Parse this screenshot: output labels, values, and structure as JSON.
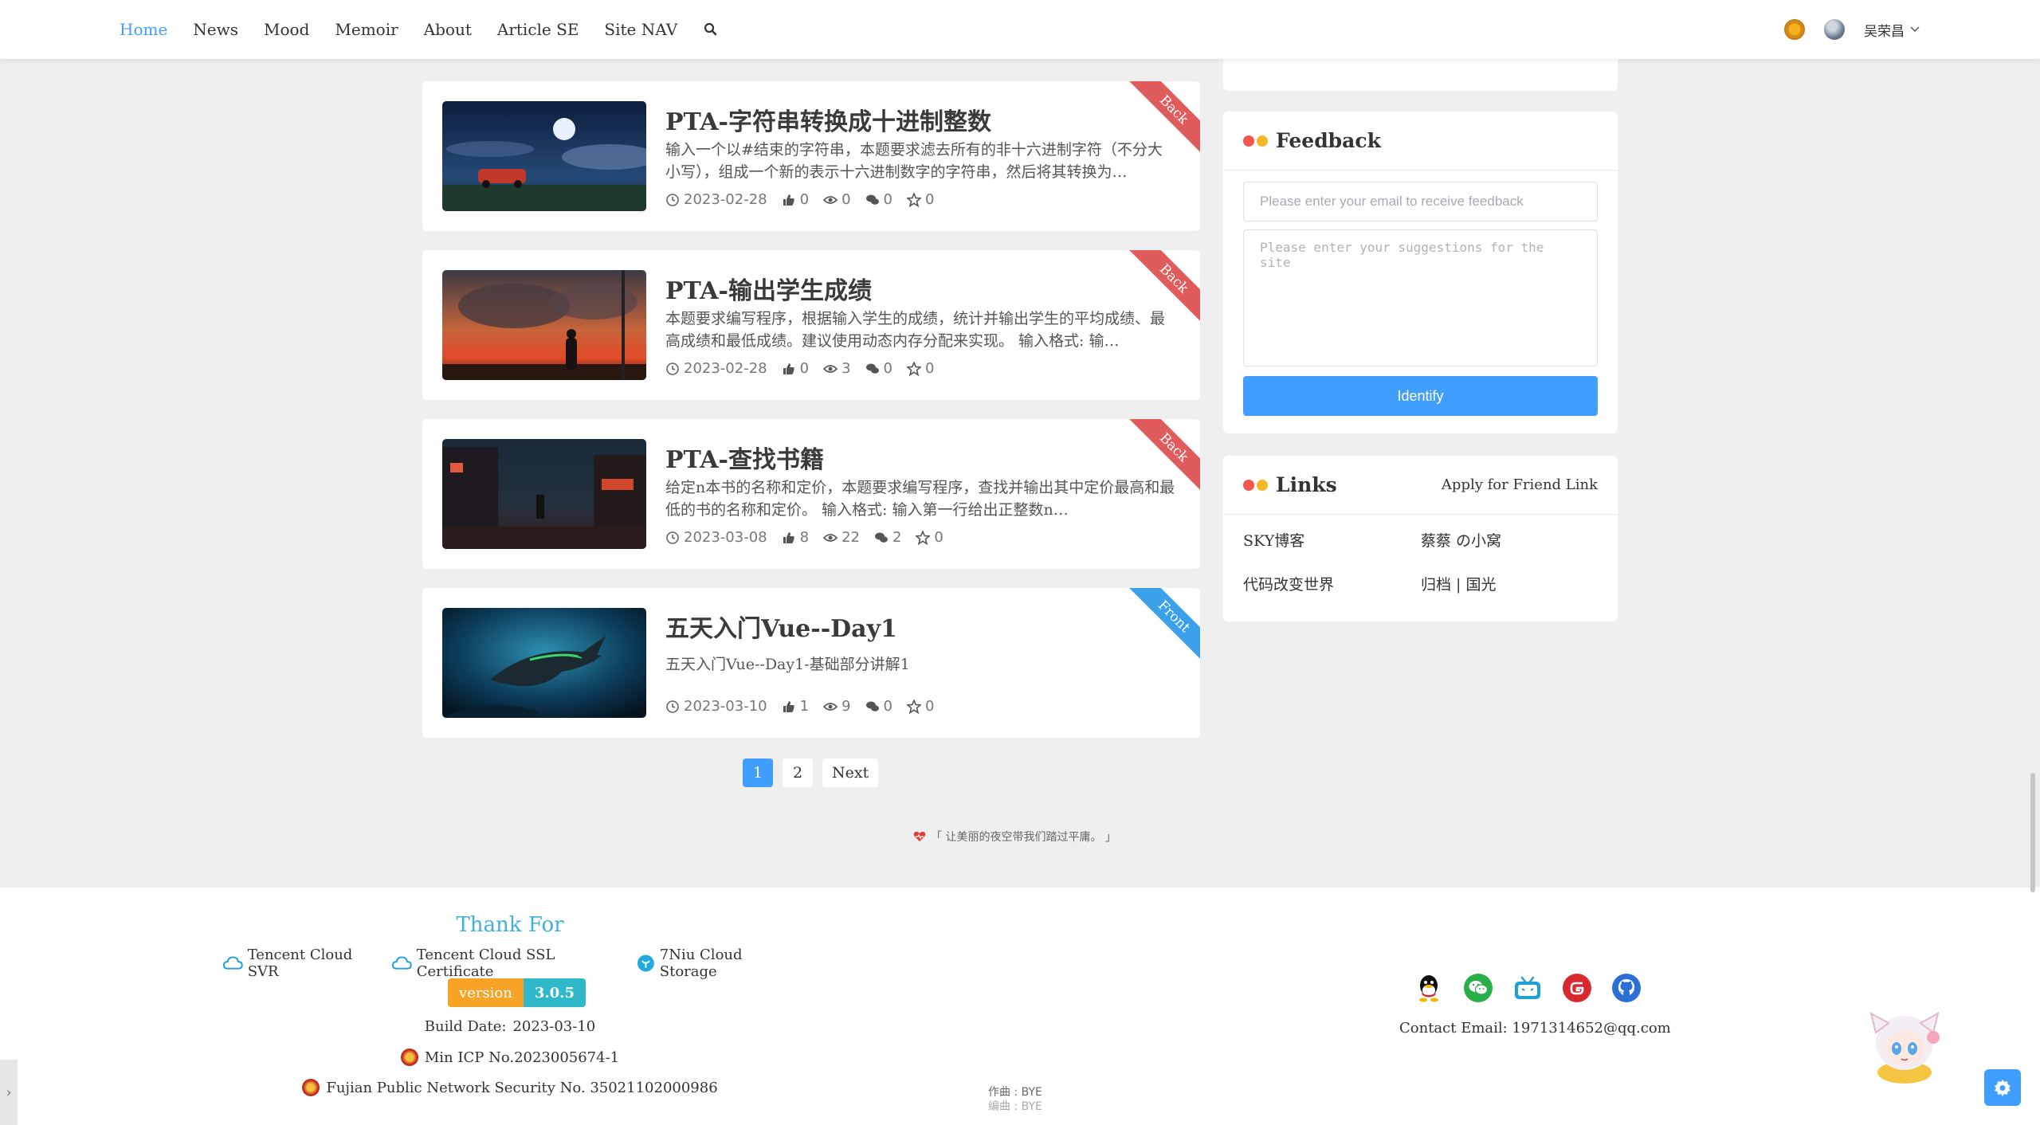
{
  "nav": {
    "items": [
      {
        "label": "Home",
        "active": true
      },
      {
        "label": "News",
        "active": false
      },
      {
        "label": "Mood",
        "active": false
      },
      {
        "label": "Memoir",
        "active": false
      },
      {
        "label": "About",
        "active": false
      },
      {
        "label": "Article SE",
        "active": false
      },
      {
        "label": "Site NAV",
        "active": false
      }
    ],
    "search_icon": "search-icon",
    "user_name": "吴荣昌"
  },
  "articles": [
    {
      "title": "PTA-字符串转换成十进制整数",
      "excerpt": "输入一个以#结束的字符串，本题要求滤去所有的非十六进制字符（不分大小写），组成一个新的表示十六进制数字的字符串，然后将其转换为…",
      "date": "2023-02-28",
      "likes": "0",
      "views": "0",
      "comments": "0",
      "stars": "0",
      "ribbon": "Back",
      "ribbon_color": "#e05b5b"
    },
    {
      "title": "PTA-输出学生成绩",
      "excerpt": "本题要求编写程序，根据输入学生的成绩，统计并输出学生的平均成绩、最高成绩和最低成绩。建议使用动态内存分配来实现。 输入格式: 输…",
      "date": "2023-02-28",
      "likes": "0",
      "views": "3",
      "comments": "0",
      "stars": "0",
      "ribbon": "Back",
      "ribbon_color": "#e05b5b"
    },
    {
      "title": "PTA-查找书籍",
      "excerpt": "给定n本书的名称和定价，本题要求编写程序，查找并输出其中定价最高和最低的书的名称和定价。 输入格式: 输入第一行给出正整数n…",
      "date": "2023-03-08",
      "likes": "8",
      "views": "22",
      "comments": "2",
      "stars": "0",
      "ribbon": "Back",
      "ribbon_color": "#e05b5b"
    },
    {
      "title": "五天入门Vue--Day1",
      "excerpt": "五天入门Vue--Day1-基础部分讲解1",
      "date": "2023-03-10",
      "likes": "1",
      "views": "9",
      "comments": "0",
      "stars": "0",
      "ribbon": "Front",
      "ribbon_color": "#3aa0ea"
    }
  ],
  "pagination": {
    "pages": [
      "1",
      "2"
    ],
    "current": "1",
    "next_label": "Next"
  },
  "quote": "「 让美丽的夜空带我们踏过平庸。 」",
  "feedback": {
    "title": "Feedback",
    "email_placeholder": "Please enter your email to receive feedback",
    "suggestion_placeholder": "Please enter your suggestions for the site",
    "submit_label": "Identify"
  },
  "links": {
    "title": "Links",
    "apply_label": "Apply for Friend Link",
    "items": [
      "SKY博客",
      "蔡蔡 の小窝",
      "代码改变世界",
      "归档 | 国光"
    ]
  },
  "footer": {
    "thank_title": "Thank For",
    "sponsors": [
      "Tencent Cloud SVR",
      "Tencent Cloud SSL Certificate",
      "7Niu Cloud Storage"
    ],
    "version_label": "version",
    "version_number": "3.0.5",
    "build_date_label": "Build Date:",
    "build_date": "2023-03-10",
    "icp": "Min ICP No.2023005674-1",
    "security": "Fujian Public Network Security No. 35021102000986",
    "music_composer": "作曲 : BYE",
    "music_arranger": "编曲 : BYE",
    "contact_label": "Contact Email:",
    "contact_email": "1971314652@qq.com",
    "socials": [
      "qq-icon",
      "wechat-icon",
      "bilibili-icon",
      "gitee-icon",
      "github-icon"
    ]
  },
  "colors": {
    "accent": "#409eff",
    "ribbon_back": "#e05b5b",
    "ribbon_front": "#3aa0ea",
    "thank_title": "#3fb1dd",
    "version_label_bg": "#f7a325",
    "version_number_bg": "#2fb8c9"
  }
}
